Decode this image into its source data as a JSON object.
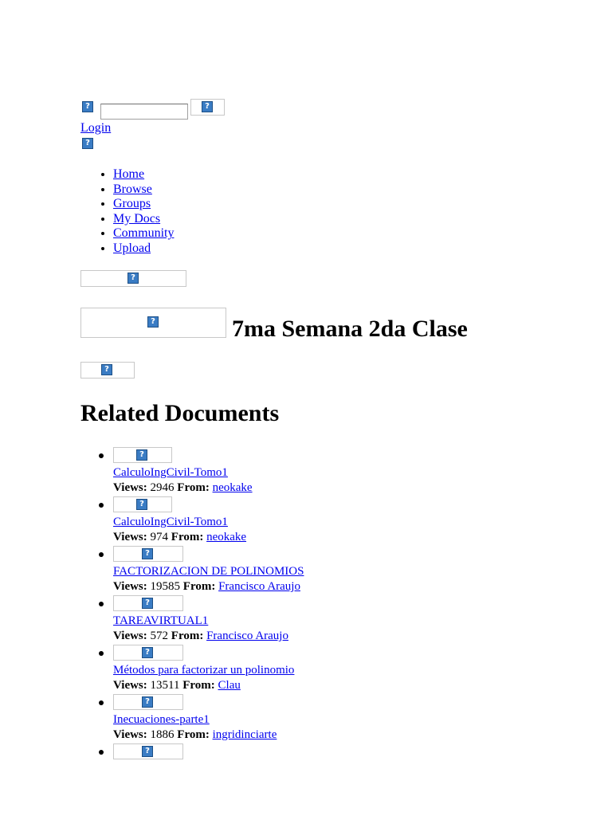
{
  "header": {
    "login_label": "Login"
  },
  "nav": {
    "items": [
      "Home",
      "Browse",
      "Groups",
      "My Docs",
      "Community",
      "Upload"
    ]
  },
  "document": {
    "title": "7ma Semana 2da Clase"
  },
  "related": {
    "heading": "Related Documents",
    "views_label": "Views:",
    "from_label": "From:",
    "items": [
      {
        "title": "CalculoIngCivil-Tomo1",
        "views": "2946",
        "author": "neokake"
      },
      {
        "title": "CalculoIngCivil-Tomo1",
        "views": "974",
        "author": "neokake"
      },
      {
        "title": "FACTORIZACION DE POLINOMIOS",
        "views": "19585",
        "author": "Francisco Araujo"
      },
      {
        "title": "TAREAVIRTUAL1",
        "views": "572",
        "author": "Francisco Araujo"
      },
      {
        "title": "Métodos para factorizar un polinomio",
        "views": "13511",
        "author": "Clau"
      },
      {
        "title": "Inecuaciones-parte1",
        "views": "1886",
        "author": "ingridinciarte"
      }
    ]
  },
  "icons": {
    "missing_image": "broken-image-icon",
    "glyph": "?"
  },
  "colors": {
    "link": "#0000ee",
    "icon_fill": "#3a7cc4"
  }
}
